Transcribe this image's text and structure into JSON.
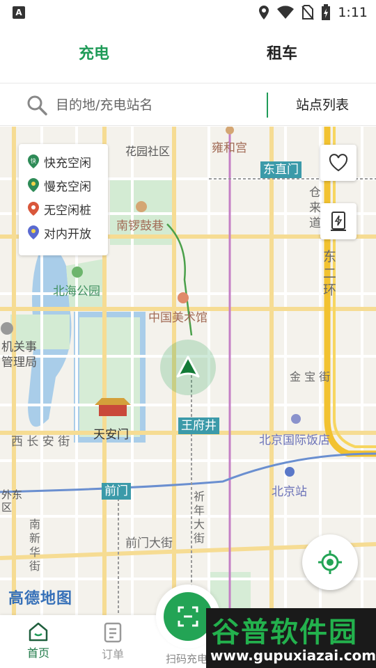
{
  "status_bar": {
    "time": "1:11",
    "left_badge": "A"
  },
  "tabs": [
    {
      "label": "充电",
      "active": true
    },
    {
      "label": "租车",
      "active": false
    }
  ],
  "search": {
    "placeholder": "目的地/充电站名",
    "station_list_label": "站点列表"
  },
  "legend": [
    {
      "label": "快充空闲",
      "badge": "快",
      "color": "#2e8b57"
    },
    {
      "label": "慢充空闲",
      "color": "#2e8b57"
    },
    {
      "label": "无空闲桩",
      "color": "#d9573b"
    },
    {
      "label": "对内开放",
      "color": "#5a6ad0"
    }
  ],
  "map": {
    "labels": {
      "huayuan": "花园社区",
      "yonghegong": "雍和宫",
      "dongzhimen": "东直门",
      "cang": "仓",
      "lai": "来",
      "dao": "道",
      "nanluoguxiang": "南锣鼓巷",
      "dong": "东",
      "er": "二",
      "huan": "环",
      "beihaigongyuan": "北海公园",
      "meishuguan": "中国美术馆",
      "jiguan1": "机关事",
      "jiguan2": "管理局",
      "jinbaojie": "金 宝 街",
      "tiananmen": "天安门",
      "wangfujing": "王府井",
      "xichangan": "西 长 安 街",
      "beijingfandian": "北京国际饭店",
      "qianmen": "前门",
      "beijingzhan": "北京站",
      "waidong": "外东",
      "qu": "区",
      "qiniandajie": "祈年大街",
      "nanxinhuajie": "南新华街",
      "qianmendajie": "前门大街",
      "logo": "高德地图"
    }
  },
  "bottom_nav": {
    "home": "首页",
    "orders": "订单",
    "scan": "扫码充电"
  },
  "watermark": {
    "title": "谷普软件园",
    "url": "www.gupuxiazai.com"
  },
  "colors": {
    "brand_green": "#1f9b58",
    "scan_green": "#23a455",
    "station_tag": "#3b9aa9"
  }
}
